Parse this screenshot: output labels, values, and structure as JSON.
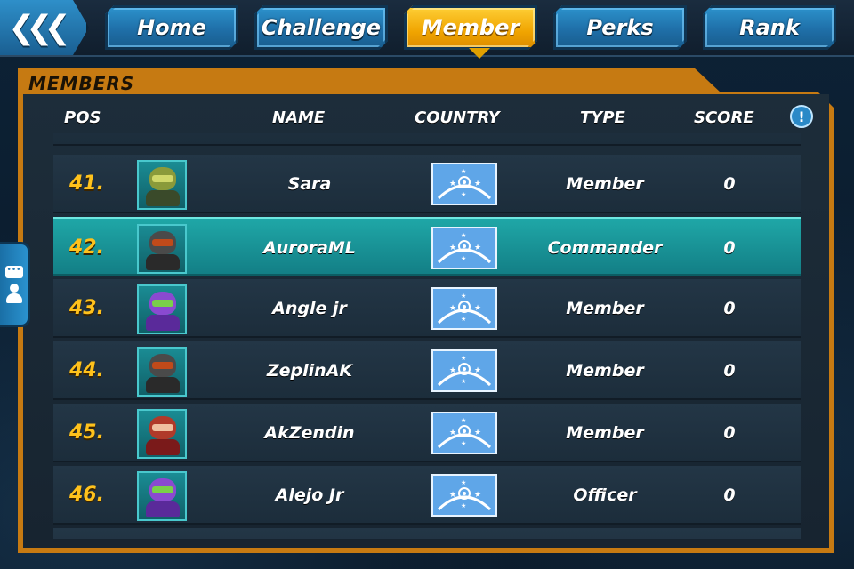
{
  "nav": {
    "back_icon": "triple-chevron-left-icon",
    "tabs": [
      {
        "label": "Home",
        "active": false
      },
      {
        "label": "Challenge",
        "active": false
      },
      {
        "label": "Member",
        "active": true
      },
      {
        "label": "Perks",
        "active": false
      },
      {
        "label": "Rank",
        "active": false
      }
    ]
  },
  "panel": {
    "title": "MEMBERS",
    "columns": {
      "pos": "POS",
      "name": "NAME",
      "country": "COUNTRY",
      "type": "TYPE",
      "score": "SCORE"
    },
    "info_icon": "!"
  },
  "members": [
    {
      "pos": "41.",
      "name": "Sara",
      "type": "Member",
      "score": "0",
      "avatar": "green-robot",
      "highlight": false
    },
    {
      "pos": "42.",
      "name": "AuroraML",
      "type": "Commander",
      "score": "0",
      "avatar": "dark-robot",
      "highlight": true
    },
    {
      "pos": "43.",
      "name": "Angle jr",
      "type": "Member",
      "score": "0",
      "avatar": "purple-robot",
      "highlight": false
    },
    {
      "pos": "44.",
      "name": "ZeplinAK",
      "type": "Member",
      "score": "0",
      "avatar": "dark-robot",
      "highlight": false
    },
    {
      "pos": "45.",
      "name": "AkZendin",
      "type": "Member",
      "score": "0",
      "avatar": "red-block",
      "highlight": false
    },
    {
      "pos": "46.",
      "name": "Alejo Jr",
      "type": "Officer",
      "score": "0",
      "avatar": "purple-robot",
      "highlight": false
    }
  ],
  "colors": {
    "accent": "#f0a400",
    "panel": "#c67a12",
    "highlight": "#1fa7a7",
    "pos_text": "#ffc21c"
  }
}
